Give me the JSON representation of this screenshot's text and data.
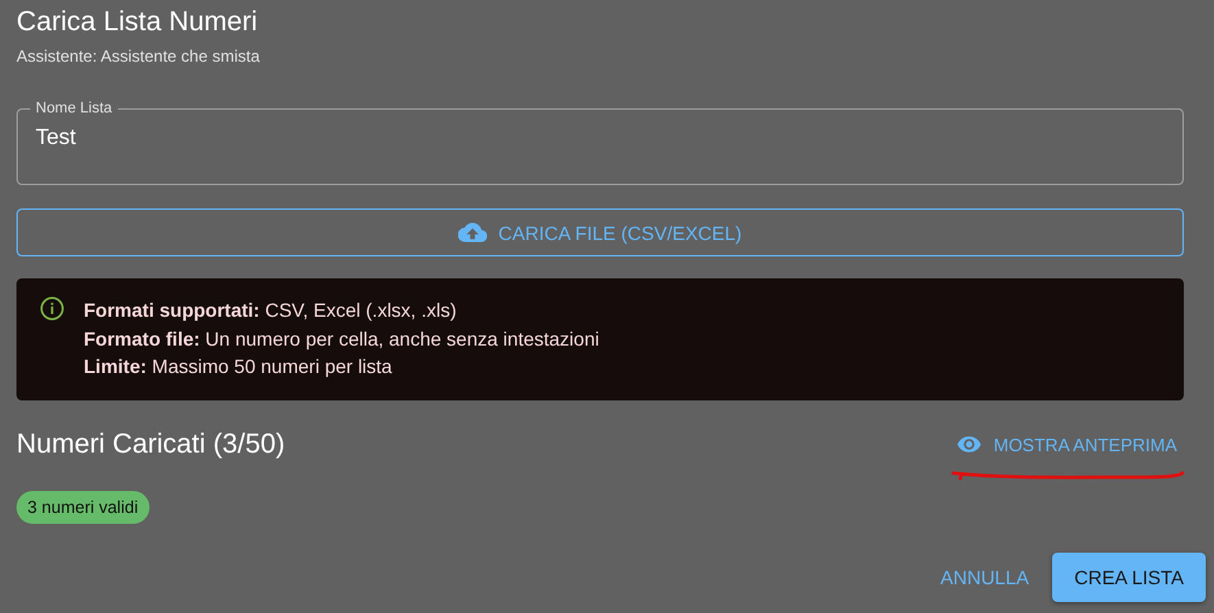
{
  "dialog": {
    "title": "Carica Lista Numeri",
    "subtitle": "Assistente: Assistente che smista"
  },
  "name_field": {
    "label": "Nome Lista",
    "value": "Test"
  },
  "upload_button": {
    "label": "CARICA FILE (CSV/EXCEL)"
  },
  "info_alert": {
    "lines": [
      "**Formati supportati:** CSV, Excel (.xlsx, .xls)",
      "**Formato file:** Un numero per cella, anche senza intestazioni",
      "**Limite:** Massimo 50 numeri per lista"
    ]
  },
  "numbers": {
    "heading": "Numeri Caricati (3/50)",
    "preview_button": "MOSTRA ANTEPRIMA",
    "chip": "3 numeri validi"
  },
  "actions": [
    {
      "label": "ANNULLA",
      "kind": "text"
    },
    {
      "label": "CREA LISTA",
      "kind": "contained"
    }
  ]
}
